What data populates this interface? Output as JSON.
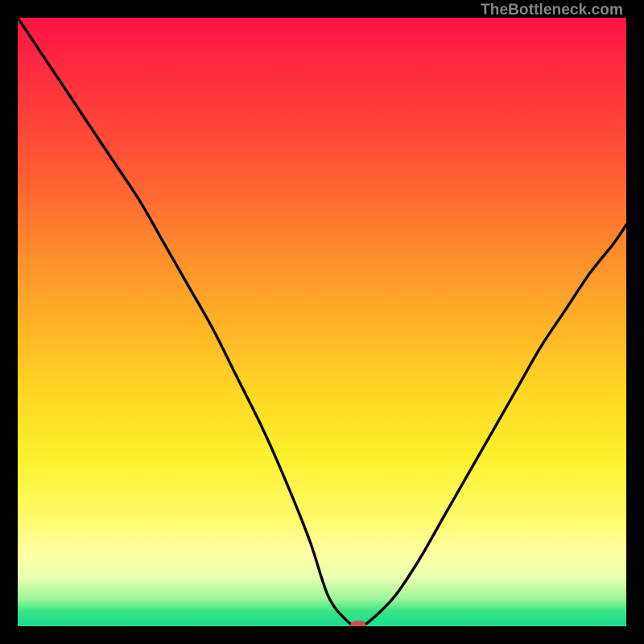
{
  "watermark": "TheBottleneck.com",
  "chart_data": {
    "type": "line",
    "title": "",
    "xlabel": "",
    "ylabel": "",
    "xlim": [
      0,
      100
    ],
    "ylim": [
      0,
      100
    ],
    "grid": false,
    "legend": false,
    "background_gradient": [
      {
        "pos": 0,
        "color": "#ff1244"
      },
      {
        "pos": 24,
        "color": "#ff5734"
      },
      {
        "pos": 50,
        "color": "#ffb228"
      },
      {
        "pos": 72,
        "color": "#fff02c"
      },
      {
        "pos": 92,
        "color": "#e9ffb0"
      },
      {
        "pos": 100,
        "color": "#18dd92"
      }
    ],
    "series": [
      {
        "name": "bottleneck-curve",
        "color": "#000000",
        "x": [
          0,
          4,
          8,
          12,
          16,
          20,
          24,
          28,
          32,
          36,
          40,
          44,
          48,
          51,
          54,
          56,
          58,
          62,
          66,
          70,
          74,
          78,
          82,
          86,
          90,
          94,
          98,
          100
        ],
        "y": [
          100,
          94,
          88,
          82,
          76,
          70,
          63,
          56,
          49,
          41,
          33,
          24,
          14,
          5,
          1,
          0,
          1,
          5,
          11,
          18,
          25,
          32,
          39,
          46,
          52,
          58,
          63,
          66
        ]
      }
    ],
    "marker": {
      "x": 56,
      "y": 0,
      "color": "#c95148"
    }
  }
}
